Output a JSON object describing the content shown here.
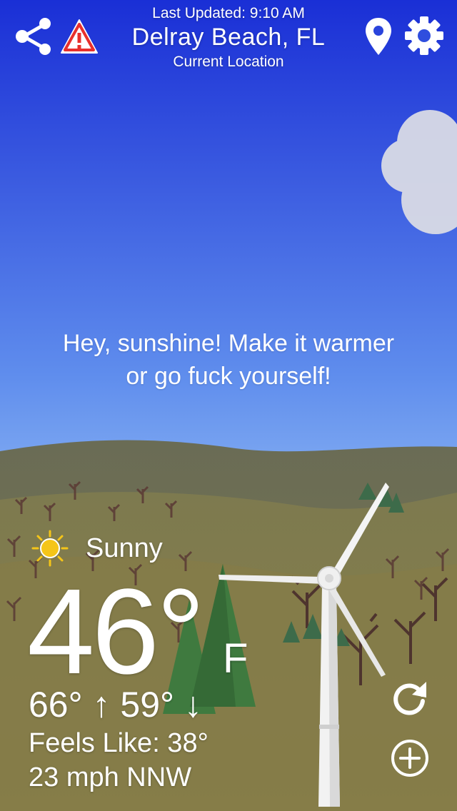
{
  "header": {
    "last_updated": "Last Updated: 9:10 AM",
    "city": "Delray Beach, FL",
    "location_label": "Current Location"
  },
  "icons": {
    "share": "share-icon",
    "alert": "alert-triangle-icon",
    "location": "map-pin-icon",
    "settings": "gear-icon",
    "refresh": "refresh-icon",
    "add": "add-circle-icon",
    "condition": "sun-icon"
  },
  "message": {
    "line1": "Hey, sunshine! Make it warmer",
    "line2": "or go fuck yourself!"
  },
  "weather": {
    "condition": "Sunny",
    "temperature": "46°",
    "unit": "F",
    "hilo": "66° ↑  59° ↓",
    "feels_like": "Feels Like: 38°",
    "wind": "23 mph NNW"
  },
  "colors": {
    "sky_top": "#1a2fd6",
    "sky_mid": "#4a74e6",
    "sky_bottom": "#7aa6ef",
    "hills_far": "#6f6e52",
    "hills_near": "#7f7a4a",
    "alert_red": "#e8302c",
    "sun_yellow": "#f5c518"
  }
}
